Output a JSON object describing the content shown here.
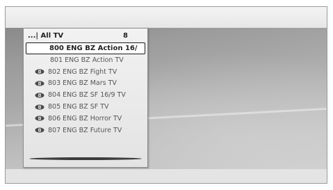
{
  "list": {
    "title": "...| All TV",
    "count": "8",
    "channels": [
      {
        "label": "800 ENG BZ Action 16/",
        "icon": null,
        "selected": true
      },
      {
        "label": "801 ENG BZ Action TV",
        "icon": null,
        "selected": false
      },
      {
        "label": "802 ENG BZ Fight TV",
        "icon": "scrambled-icon",
        "selected": false
      },
      {
        "label": "803 ENG BZ Mars TV",
        "icon": "scrambled-icon",
        "selected": false
      },
      {
        "label": "804 ENG BZ SF 16/9 TV",
        "icon": "scrambled-icon",
        "selected": false
      },
      {
        "label": "805 ENG BZ SF TV",
        "icon": "scrambled-icon",
        "selected": false
      },
      {
        "label": "806 ENG BZ Horror TV",
        "icon": "scrambled-icon",
        "selected": false
      },
      {
        "label": "807 ENG BZ Future TV",
        "icon": "scrambled-icon",
        "selected": false
      }
    ]
  }
}
